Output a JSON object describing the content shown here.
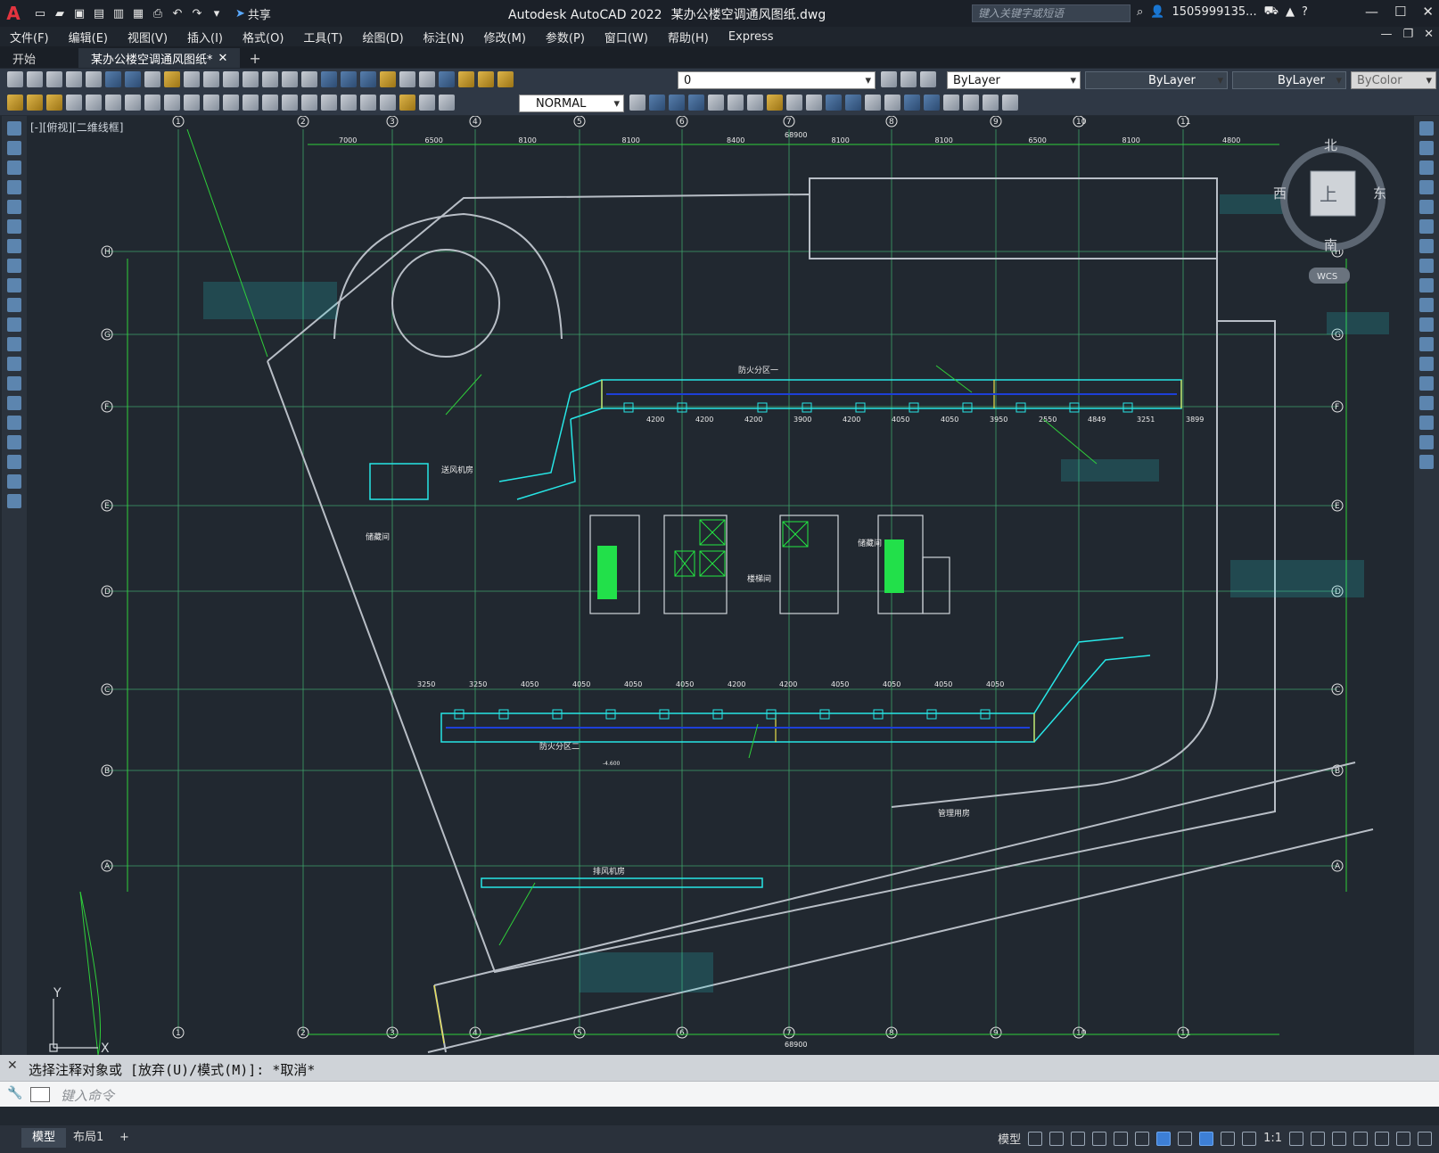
{
  "window": {
    "app_title": "Autodesk AutoCAD 2022",
    "file_title": "某办公楼空调通风图纸.dwg",
    "share_label": "共享",
    "search_placeholder": "键入关键字或短语",
    "user": "1505999135..."
  },
  "menu": [
    "文件(F)",
    "编辑(E)",
    "视图(V)",
    "插入(I)",
    "格式(O)",
    "工具(T)",
    "绘图(D)",
    "标注(N)",
    "修改(M)",
    "参数(P)",
    "窗口(W)",
    "帮助(H)",
    "Express"
  ],
  "tabs": {
    "start": "开始",
    "active": "某办公楼空调通风图纸*"
  },
  "toolbar": {
    "layer_value": "0",
    "color_value": "ByLayer",
    "linetype_value": "ByLayer",
    "lineweight_value": "ByLayer",
    "plotstyle_value": "ByColor",
    "dimstyle_value": "NORMAL"
  },
  "viewport": {
    "label": "[-][俯视][二维线框]",
    "viewcube": {
      "north": "北",
      "south": "南",
      "east": "东",
      "west": "西",
      "top": "上",
      "wcs": "WCS"
    },
    "ucs": {
      "x": "X",
      "y": "Y"
    }
  },
  "drawing": {
    "column_labels": [
      "1",
      "2",
      "3",
      "4",
      "5",
      "6",
      "7",
      "8",
      "9",
      "10",
      "11"
    ],
    "row_labels": [
      "H",
      "G",
      "F",
      "E",
      "D",
      "C",
      "B",
      "A"
    ],
    "overall_dim": "68900",
    "top_dims": [
      "7000",
      "6500",
      "8100",
      "8100",
      "8400",
      "8100",
      "8100",
      "6500",
      "8100",
      "4800"
    ],
    "duct_dims_upper": [
      "4200",
      "4200",
      "4200",
      "3900",
      "4200",
      "4050",
      "4050",
      "3950",
      "2550",
      "4849",
      "3251",
      "3899"
    ],
    "duct_dims_lower": [
      "3250",
      "3250",
      "4050",
      "4050",
      "4050",
      "4050",
      "4200",
      "4200",
      "4050",
      "4050",
      "4050",
      "4050"
    ],
    "labels": {
      "fire_zone_1": "防火分区一",
      "fire_zone_2": "防火分区二",
      "stair_room": "楼梯间",
      "storage": "储藏间",
      "equip_room": "送风机房",
      "fan_room": "排风机房",
      "ele": "-4.600",
      "mgmt": "管理用房"
    }
  },
  "command": {
    "output": "选择注释对象或 [放弃(U)/模式(M)]: *取消*",
    "placeholder": "键入命令"
  },
  "status": {
    "model_tab": "模型",
    "layout_tab": "布局1",
    "model_label": "模型",
    "scale": "1:1"
  }
}
